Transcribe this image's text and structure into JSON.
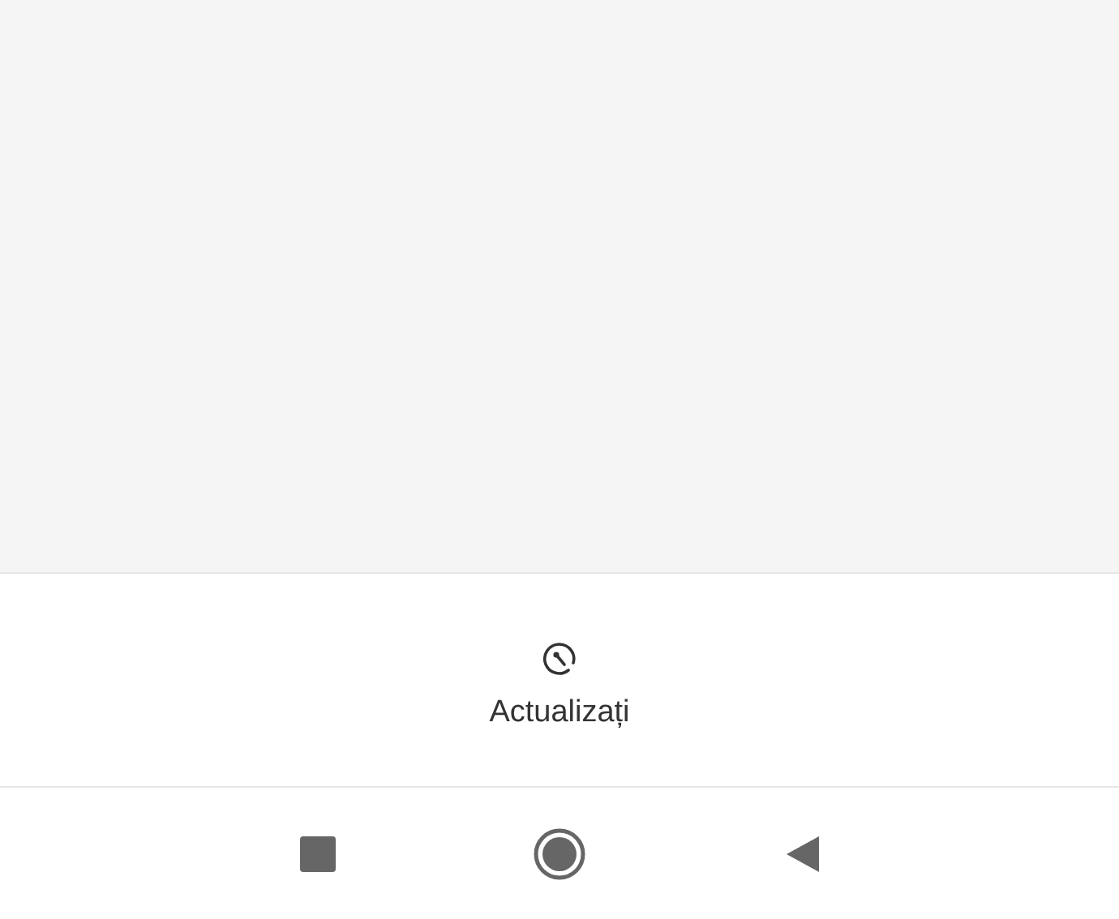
{
  "update_button": {
    "label": "Actualizați"
  }
}
